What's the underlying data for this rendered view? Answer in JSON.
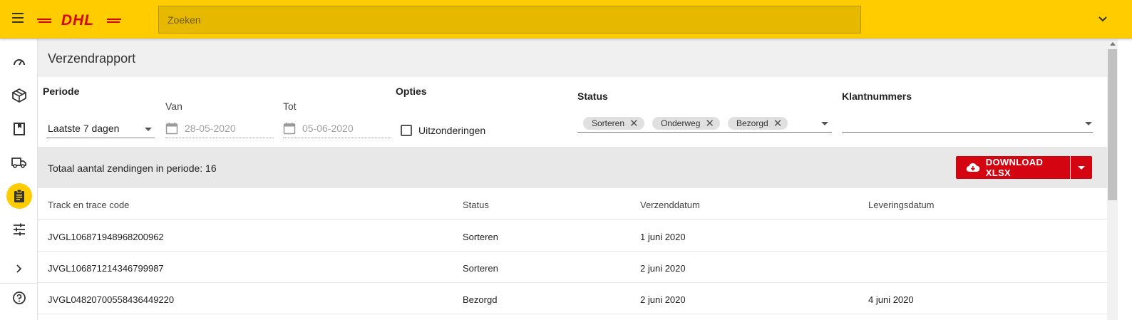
{
  "header": {
    "logo_text": "DHL",
    "search_placeholder": "Zoeken",
    "brand_color": "#ffcc00"
  },
  "sidebar": {
    "items": [
      {
        "icon": "speedometer-icon"
      },
      {
        "icon": "package-icon"
      },
      {
        "icon": "book-icon"
      },
      {
        "icon": "truck-icon"
      },
      {
        "icon": "clipboard-icon",
        "active": true
      },
      {
        "icon": "sliders-icon"
      },
      {
        "icon": "chevron-right-icon"
      },
      {
        "icon": "help-icon"
      }
    ]
  },
  "page": {
    "title": "Verzendrapport"
  },
  "filters": {
    "periode_label": "Periode",
    "periode_value": "Laatste 7 dagen",
    "van_label": "Van",
    "van_value": "28-05-2020",
    "tot_label": "Tot",
    "tot_value": "05-06-2020",
    "opties_label": "Opties",
    "uitzonderingen_label": "Uitzonderingen",
    "status_label": "Status",
    "status_chips": [
      "Sorteren",
      "Onderweg",
      "Bezorgd"
    ],
    "klantnummers_label": "Klantnummers"
  },
  "summary": {
    "text": "Totaal aantal zendingen in periode: 16",
    "download_label": "DOWNLOAD XLSX",
    "accent_color": "#d40511"
  },
  "table": {
    "headers": [
      "Track en trace code",
      "Status",
      "Verzenddatum",
      "Leveringsdatum"
    ],
    "rows": [
      [
        "JVGL106871948968200962",
        "Sorteren",
        "1 juni 2020",
        ""
      ],
      [
        "JVGL106871214346799987",
        "Sorteren",
        "2 juni 2020",
        ""
      ],
      [
        "JVGL04820700558436449220",
        "Bezorgd",
        "2 juni 2020",
        "4 juni 2020"
      ]
    ]
  }
}
